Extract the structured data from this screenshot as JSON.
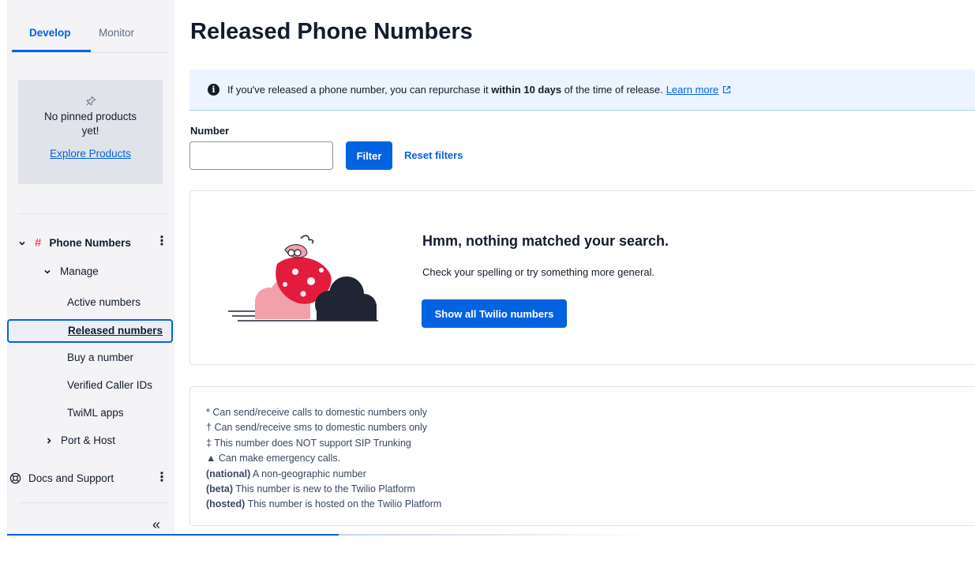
{
  "sidebar": {
    "tabs": [
      {
        "label": "Develop",
        "active": true
      },
      {
        "label": "Monitor",
        "active": false
      }
    ],
    "pinned": {
      "icon": "pin-icon",
      "text": "No pinned products yet!",
      "link": "Explore Products"
    },
    "nav": {
      "phone_numbers": "Phone Numbers",
      "manage": "Manage",
      "active_numbers": "Active numbers",
      "released_numbers": "Released numbers",
      "buy_number": "Buy a number",
      "verified_caller_ids": "Verified Caller IDs",
      "twiml_apps": "TwiML apps",
      "port_host": "Port & Host",
      "docs_support": "Docs and Support"
    },
    "collapse_glyph": "«"
  },
  "page": {
    "title": "Released Phone Numbers"
  },
  "banner": {
    "text_before": "If you've released a phone number, you can repurchase it ",
    "bold": "within 10 days",
    "text_after": " of the time of release.",
    "link": "Learn more"
  },
  "filter": {
    "label": "Number",
    "input_value": "",
    "button": "Filter",
    "reset": "Reset filters"
  },
  "empty_state": {
    "heading": "Hmm, nothing matched your search.",
    "subtext": "Check your spelling or try something more general.",
    "button": "Show all Twilio numbers"
  },
  "legend": [
    {
      "prefix": "*",
      "bold": "",
      "text": "Can send/receive calls to domestic numbers only"
    },
    {
      "prefix": "†",
      "bold": "",
      "text": "Can send/receive sms to domestic numbers only"
    },
    {
      "prefix": "‡",
      "bold": "",
      "text": "This number does NOT support SIP Trunking"
    },
    {
      "prefix": "▲",
      "bold": "",
      "text": "Can make emergency calls."
    },
    {
      "prefix": "",
      "bold": "(national)",
      "text": "A non-geographic number"
    },
    {
      "prefix": "",
      "bold": "(beta)",
      "text": "This number is new to the Twilio Platform"
    },
    {
      "prefix": "",
      "bold": "(hosted)",
      "text": "This number is hosted on the Twilio Platform"
    }
  ],
  "colors": {
    "accent": "#0263e0",
    "sidebar_bg": "#f4f4f6",
    "banner_bg": "#ebf4ff",
    "illustration_red": "#e31c3d",
    "illustration_pink": "#f2a0ab",
    "illustration_dark": "#1f2532"
  }
}
